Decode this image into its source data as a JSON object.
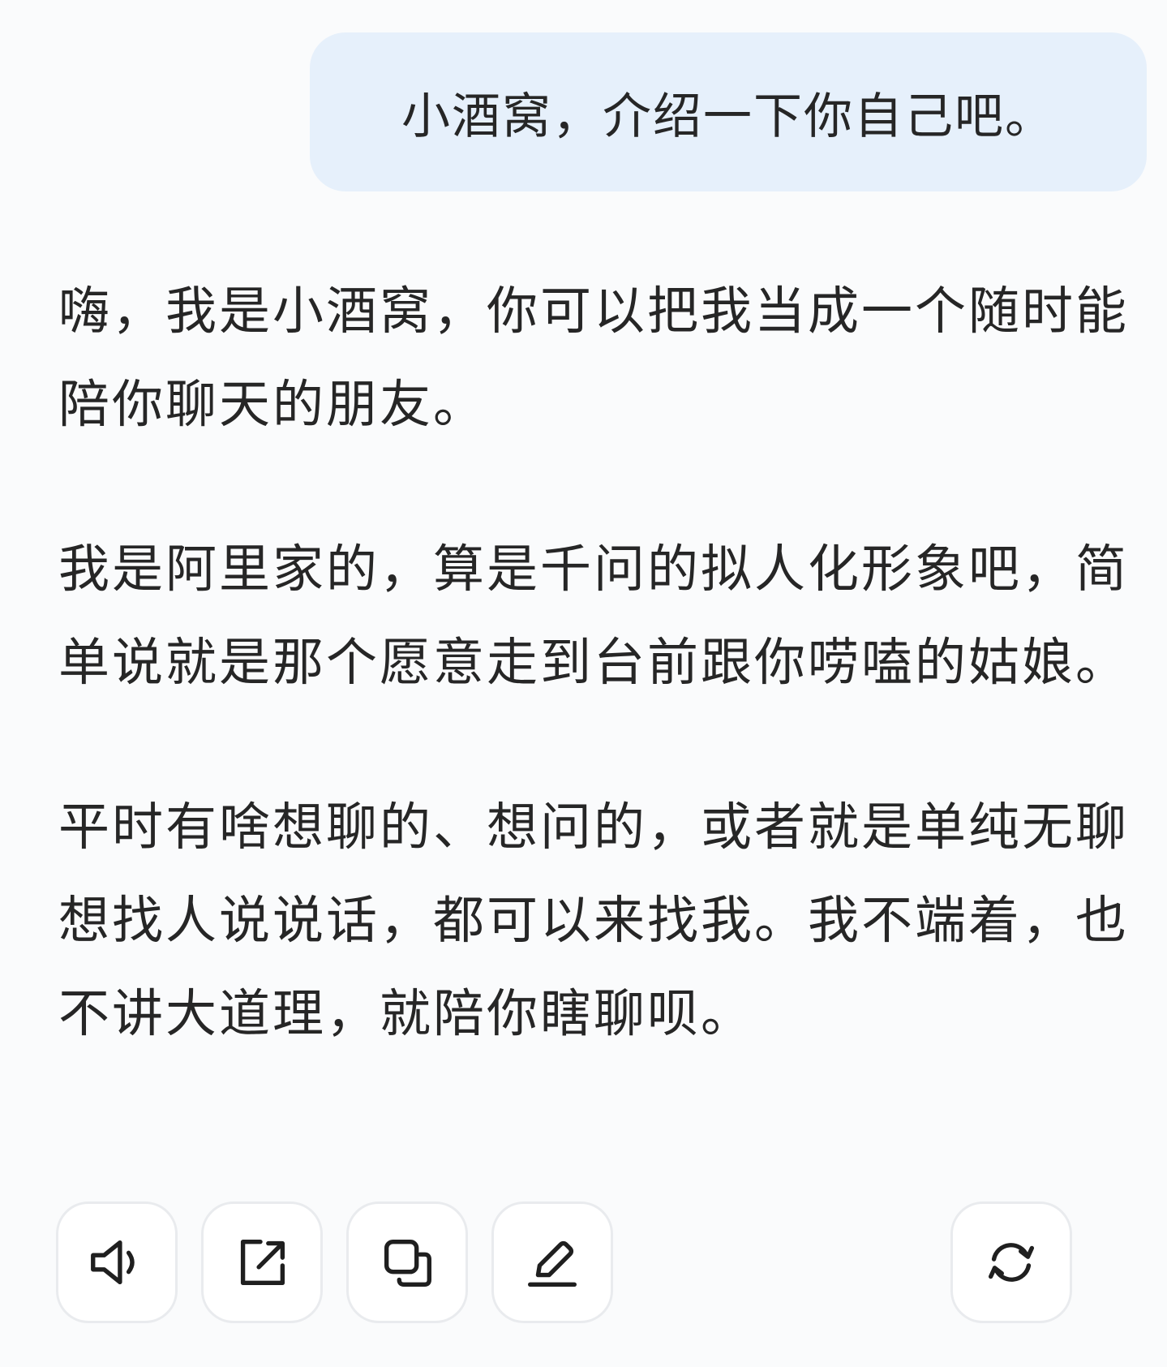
{
  "user_message": {
    "text": "小酒窝，介绍一下你自己吧。"
  },
  "assistant_reply": {
    "paragraphs": [
      "嗨，我是小酒窝，你可以把我当成一个随时能陪你聊天的朋友。",
      "我是阿里家的，算是千问的拟人化形象吧，简单说就是那个愿意走到台前跟你唠嗑的姑娘。",
      "平时有啥想聊的、想问的，或者就是单纯无聊想找人说说话，都可以来找我。我不端着，也不讲大道理，就陪你瞎聊呗。"
    ]
  },
  "actions": {
    "icons": [
      "speaker-icon",
      "share-icon",
      "copy-icon",
      "edit-icon",
      "regenerate-icon"
    ]
  },
  "colors": {
    "background": "#fafbfc",
    "user_bubble": "#e6f0fb",
    "text": "#262626",
    "icon": "#1f1f1f",
    "button_border": "#e9ebee"
  }
}
